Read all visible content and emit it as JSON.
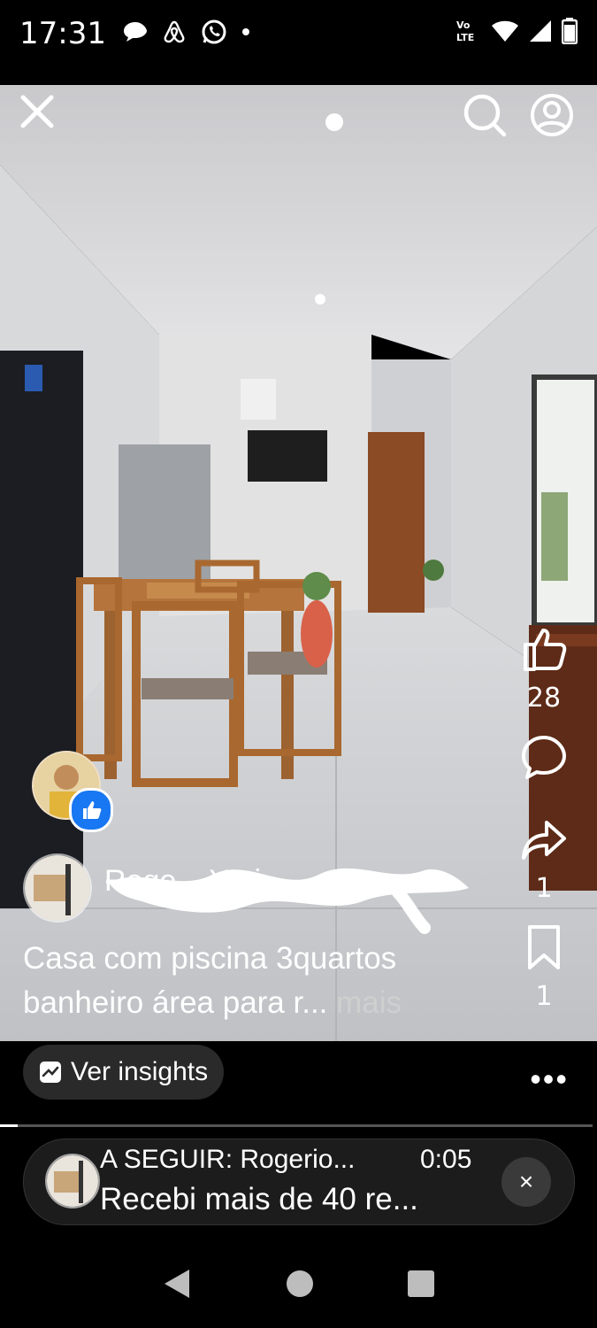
{
  "status_bar": {
    "time": "17:31",
    "network_label": "Vo)) LTE",
    "left_icons": [
      "chat-bubble-icon",
      "airbnb-icon",
      "whatsapp-icon",
      "dot-icon"
    ],
    "right_icons": [
      "wifi-icon",
      "signal-icon",
      "battery-icon"
    ]
  },
  "video": {
    "like_count": "28",
    "share_count": "1",
    "save_count": "1",
    "author_name": "Roge... Yzri",
    "caption_text": "Casa com piscina 3quartos banheiro área para r...",
    "caption_more": " mais"
  },
  "actions": {
    "insights_label": "Ver insights",
    "more_label": "•••"
  },
  "progress": {
    "fraction": 0.03
  },
  "up_next": {
    "title": "A SEGUIR: Rogerio...",
    "duration": "0:05",
    "subtitle": "Recebi mais de 40 re...",
    "close_label": "×"
  },
  "colors": {
    "accent_blue": "#1877f2",
    "background": "#000000"
  }
}
